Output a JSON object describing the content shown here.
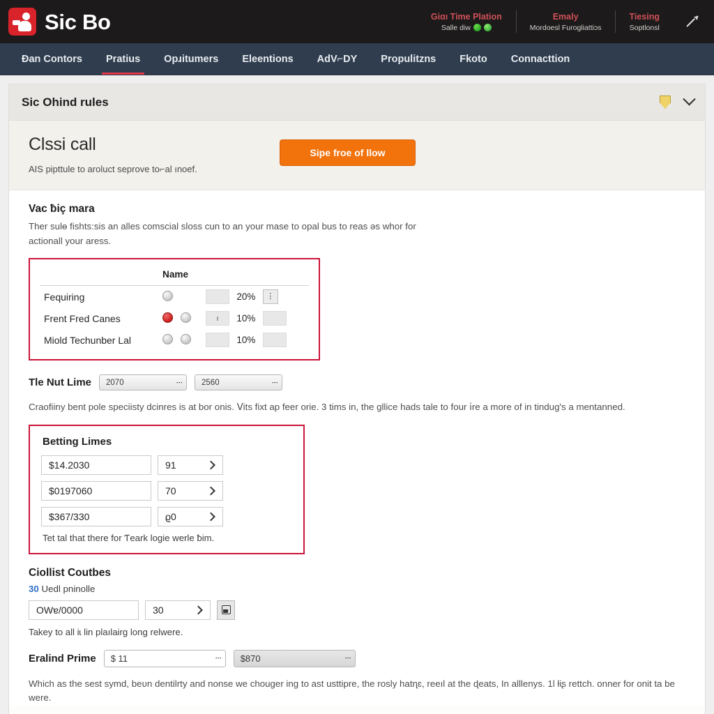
{
  "header": {
    "brand": "Sic Bo",
    "logo_icon": "person-hand-icon",
    "logo_color": "#d8232a",
    "right_cells": [
      {
        "title": "Giɑı Time Plation",
        "subtitle": "Salle diw",
        "dots": [
          "green-dot",
          "green-dot"
        ]
      },
      {
        "title": "Emaly",
        "subtitle": "Mordoesl Furogliattiɔs",
        "dots": []
      },
      {
        "title": "Tiesing",
        "subtitle": "Soptlonsl",
        "dots": []
      }
    ],
    "trailing_icon": "phone-call-icon"
  },
  "nav": {
    "items": [
      {
        "label": "Ɖan Contors",
        "active": false
      },
      {
        "label": "Pratius",
        "active": true
      },
      {
        "label": "Opɹitumers",
        "active": false
      },
      {
        "label": "Eleentions",
        "active": false
      },
      {
        "label": "AdV⌐DY",
        "active": false
      },
      {
        "label": "Propulitzns",
        "active": false
      },
      {
        "label": "Fkoto",
        "active": false
      },
      {
        "label": "Connacttion",
        "active": false
      }
    ],
    "active_underline_color": "#e03a4a"
  },
  "card": {
    "title": "Sic Ohind rules",
    "shield_icon": "shield-icon",
    "collapse_icon": "chevron-down-icon"
  },
  "hero": {
    "heading": "Clssi call",
    "description": "AIS pipttule to aroluct seprove to⌐al ınoef.",
    "cta_label": "Sipe froe of llow",
    "cta_color": "#f2720c"
  },
  "section_one": {
    "heading": "Vac ƀiç mara",
    "paragraph": "Ther sulɵ fishts:sis an alles comscial sloss cun to an your mase to opal bus to reas ǝs whor for actionall your aress.",
    "table": {
      "columns": [
        "",
        "Name",
        "",
        ""
      ],
      "rows": [
        {
          "label": "Fequiring",
          "radios": [
            "gray"
          ],
          "field": "",
          "percent": "20%",
          "kebab": true,
          "trailing_box": false
        },
        {
          "label": "Frent Fred Canes",
          "radios": [
            "red",
            "gray"
          ],
          "field": "ı",
          "percent": "10%",
          "kebab": false,
          "trailing_box": true
        },
        {
          "label": "Miold Techunber Lal",
          "radios": [
            "gray",
            "gray"
          ],
          "field": "",
          "percent": "10%",
          "kebab": false,
          "trailing_box": true
        }
      ]
    }
  },
  "section_two": {
    "label": "Tle Nut Lime",
    "select_one": "2070",
    "select_two": "2560",
    "paragraph": "Craofiiny bent pole speciisty dcinres is at bor onis. Ⅴits fixt ap feer orie. 3 tims in, the gllice hads tale to four ⅰre a more of in tindug's a mentanned."
  },
  "betting_limits": {
    "heading": "Betting Limes",
    "rows": [
      {
        "amount": "$14.2030",
        "count": "91"
      },
      {
        "amount": "$0197060",
        "count": "70"
      },
      {
        "amount": "$367/330",
        "count": "ϱ0"
      }
    ],
    "note": "Tet tal that there for Ƭeark logie werle ƀim."
  },
  "collist": {
    "heading": "Ciollist Coutbes",
    "count": "30",
    "count_label": "Uedl pninolle",
    "field_value": "OWɐ/0000",
    "step_value": "30",
    "action_icon": "save-icon",
    "note": "Takey to all iɩ lin plaılairg long relwere."
  },
  "final": {
    "label": "Eralind Prime",
    "select_one": "$ 11",
    "select_two": "$870",
    "paragraph": "Which as the sest symd, beʋn dentilrty and nonse we chouger ing to ast usttipre, the rosly hatɳɛ, reeıl at the ɖeats, In alllenys. 1l ƚiʂ rettch. onner for onit ta be were."
  }
}
